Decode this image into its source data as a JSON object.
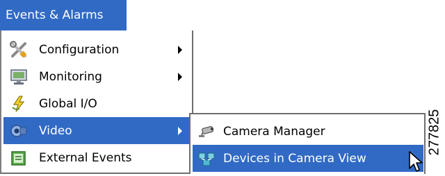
{
  "menubar": {
    "label": "Events & Alarms"
  },
  "menu": {
    "items": [
      {
        "label": "Configuration",
        "icon": "tools-icon",
        "has_submenu": true
      },
      {
        "label": "Monitoring",
        "icon": "monitor-icon",
        "has_submenu": true
      },
      {
        "label": "Global I/O",
        "icon": "global-io-icon",
        "has_submenu": false
      },
      {
        "label": "Video",
        "icon": "video-camera-icon",
        "has_submenu": true,
        "selected": true
      },
      {
        "label": "External Events",
        "icon": "external-events-icon",
        "has_submenu": false
      }
    ]
  },
  "submenu": {
    "items": [
      {
        "label": "Camera Manager",
        "icon": "camera-icon"
      },
      {
        "label": "Devices in Camera View",
        "icon": "devices-icon",
        "selected": true
      }
    ]
  },
  "figure_id": "277825",
  "colors": {
    "highlight": "#316ac5",
    "highlight_text": "#ffffff"
  }
}
